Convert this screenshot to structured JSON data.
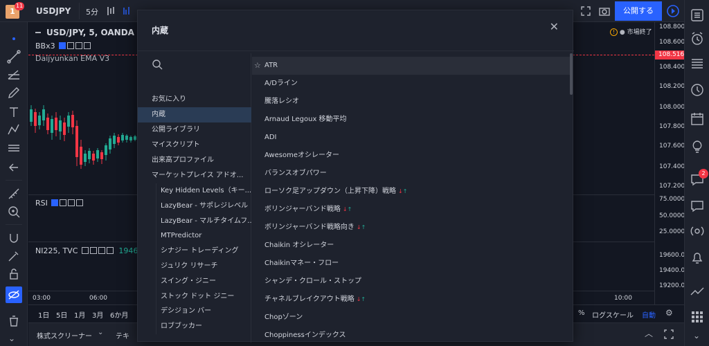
{
  "topbar": {
    "avatar_letter": "1",
    "avatar_badge": "11",
    "symbol": "USDJPY",
    "interval": "5分",
    "publish_label": "公開する"
  },
  "main_pane": {
    "title": "USD/JPY, 5, OANDA",
    "indicator1": "BBx3",
    "indicator2": "Daijyunkan EMA V3",
    "market_status": "市場終了",
    "price_ticks": [
      "108.800",
      "108.600",
      "108.400",
      "108.200",
      "108.000",
      "107.800",
      "107.600",
      "107.400",
      "107.200"
    ],
    "current_price": "108.516"
  },
  "rsi_pane": {
    "label": "RSI",
    "ticks": [
      "75.0000",
      "50.0000",
      "25.0000"
    ]
  },
  "ni_pane": {
    "label": "NI225, TVC",
    "value": "1946",
    "ticks": [
      "19600.0",
      "19400.0",
      "19200.0"
    ]
  },
  "time_axis": [
    "03:00",
    "06:00",
    "10:00"
  ],
  "bottom_toolbar": {
    "ranges": [
      "1日",
      "5日",
      "1月",
      "3月",
      "6か月"
    ],
    "percent": "%",
    "log": "ログスケール",
    "auto": "自動"
  },
  "bottom_tabs": {
    "screener": "株式スクリーナー",
    "text_tab": "テキ"
  },
  "right_badge": "2",
  "dialog": {
    "title": "内蔵",
    "categories": [
      {
        "label": "お気に入り"
      },
      {
        "label": "内蔵",
        "selected": true
      },
      {
        "label": "公開ライブラリ"
      },
      {
        "label": "マイスクリプト"
      },
      {
        "label": "出来高プロファイル"
      },
      {
        "label": "マーケットプレイス アドオ..."
      }
    ],
    "sub_items": [
      "Key Hidden Levels（キー...",
      "LazyBear - サポレジレベル",
      "LazyBear - マルチタイムフ...",
      "MTPredictor",
      "シナジー トレーディング",
      "ジュリク リサーチ",
      "スイング・ジニー",
      "ストック ドット ジニー",
      "デシジョン バー",
      "ロブブッカー"
    ],
    "indicators": [
      {
        "label": "ATR",
        "star": true
      },
      {
        "label": "A/Dライン"
      },
      {
        "label": "騰落レシオ"
      },
      {
        "label": "Arnaud Legoux 移動平均"
      },
      {
        "label": "ADI"
      },
      {
        "label": "Awesomeオシレーター"
      },
      {
        "label": "バランスオブパワー"
      },
      {
        "label": "ローソク足アップダウン（上昇下降）戦略",
        "arrows": true
      },
      {
        "label": "ボリンジャーバンド戦略",
        "arrows": true
      },
      {
        "label": "ボリンジャーバンド戦略向き",
        "arrows": true
      },
      {
        "label": "Chaikin オシレーター"
      },
      {
        "label": "Chaikinマネー・フロー"
      },
      {
        "label": "シャンデ・クロール・ストップ"
      },
      {
        "label": "チャネルブレイクアウト戦略",
        "arrows": true
      },
      {
        "label": "Chopゾーン"
      },
      {
        "label": "Choppinessインデックス"
      }
    ],
    "arrow_down": "↓",
    "arrow_up": "↑"
  },
  "colors": {
    "accent": "#2962ff",
    "price_tag": "#f23645",
    "up": "#22ab94",
    "down": "#f23645",
    "selected_bg": "#2a3c55"
  }
}
